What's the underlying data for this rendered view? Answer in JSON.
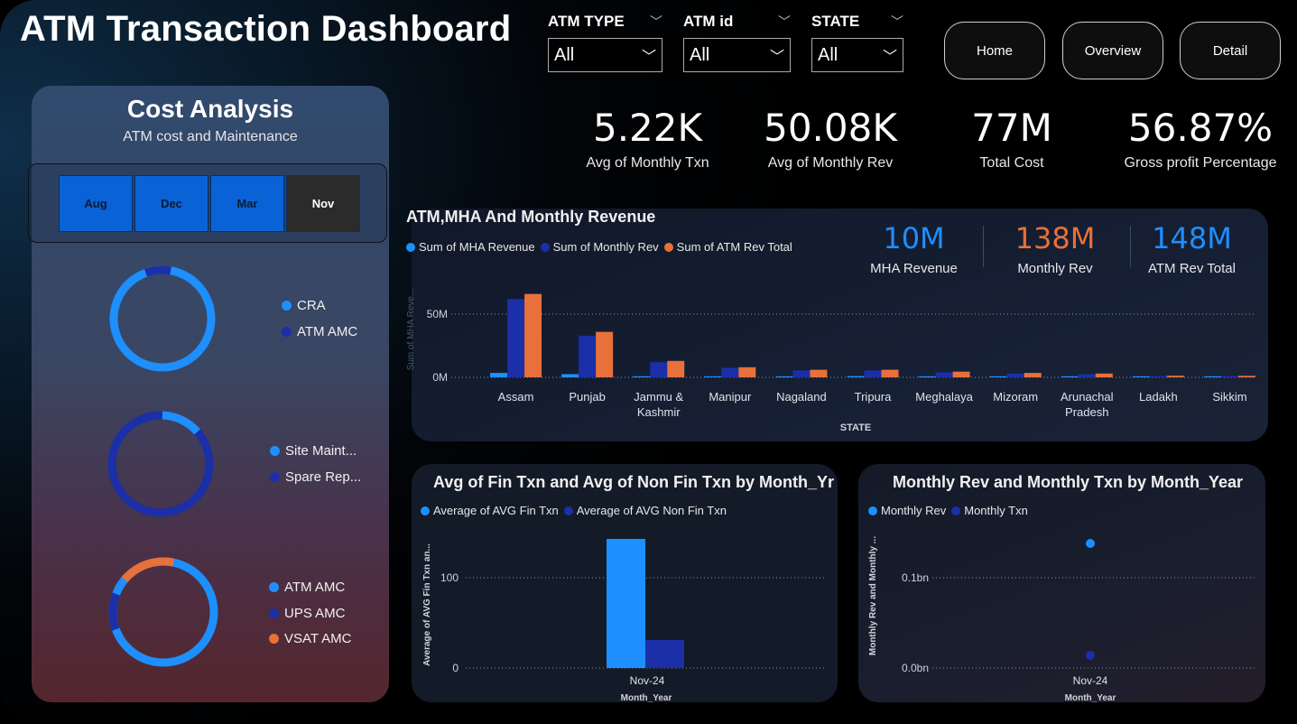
{
  "header": {
    "title": "ATM Transaction Dashboard"
  },
  "slicers": [
    {
      "label": "ATM TYPE",
      "value": "All"
    },
    {
      "label": "ATM id",
      "value": "All"
    },
    {
      "label": "STATE",
      "value": "All"
    }
  ],
  "nav": {
    "home": "Home",
    "overview": "Overview",
    "detail": "Detail"
  },
  "kpis": [
    {
      "value": "5.22K",
      "label": "Avg of Monthly Txn"
    },
    {
      "value": "50.08K",
      "label": "Avg of Monthly Rev"
    },
    {
      "value": "77M",
      "label": "Total Cost"
    },
    {
      "value": "56.87%",
      "label": "Gross profit Percentage"
    }
  ],
  "cost_panel": {
    "title": "Cost Analysis",
    "subtitle": "ATM cost and Maintenance",
    "months": [
      {
        "label": "Aug",
        "selected": false
      },
      {
        "label": "Dec",
        "selected": false
      },
      {
        "label": "Mar",
        "selected": false
      },
      {
        "label": "Nov",
        "selected": true
      }
    ],
    "donut1_legend": [
      "CRA",
      "ATM AMC"
    ],
    "donut2_legend": [
      "Site Maint...",
      "Spare Rep..."
    ],
    "donut3_legend": [
      "ATM AMC",
      "UPS AMC",
      "VSAT AMC"
    ]
  },
  "main_card": {
    "title": "ATM,MHA And Monthly Revenue",
    "legend": [
      "Sum of MHA Revenue",
      "Sum of Monthly Rev",
      "Sum of ATM Rev Total"
    ],
    "kpis": [
      {
        "value": "10M",
        "label": "MHA Revenue",
        "color": "#1e8fff"
      },
      {
        "value": "138M",
        "label": "Monthly Rev",
        "color": "#e8703a"
      },
      {
        "value": "148M",
        "label": "ATM Rev Total",
        "color": "#1e8fff"
      }
    ],
    "yaxis_label": "Sum of MHA Reve...",
    "xaxis_label": "STATE",
    "yticks": [
      "0M",
      "50M"
    ]
  },
  "fin_card": {
    "title": "Avg of Fin Txn and Avg of Non Fin Txn by Month_Yr",
    "legend": [
      "Average of AVG Fin Txn",
      "Average of AVG Non Fin Txn"
    ],
    "yaxis_label": "Average of AVG Fin Txn an...",
    "xaxis_label": "Month_Year",
    "yticks": [
      "0",
      "100"
    ]
  },
  "rev_card": {
    "title": "Monthly Rev and Monthly Txn by Month_Year",
    "legend": [
      "Monthly Rev",
      "Monthly Txn"
    ],
    "yaxis_label": "Monthly Rev and Monthly ...",
    "xaxis_label": "Month_Year",
    "yticks": [
      "0.0bn",
      "0.1bn"
    ]
  },
  "colors": {
    "mha": "#1e8fff",
    "monthly": "#1a2fa8",
    "atm": "#e8703a"
  },
  "chart_data": [
    {
      "type": "bar",
      "categories": [
        "Assam",
        "Punjab",
        "Jammu & Kashmir",
        "Manipur",
        "Nagaland",
        "Tripura",
        "Meghalaya",
        "Mizoram",
        "Arunachal Pradesh",
        "Ladakh",
        "Sikkim"
      ],
      "series": [
        {
          "name": "Sum of MHA Revenue",
          "values": [
            3.5,
            2.5,
            0.8,
            0.4,
            0.6,
            1.0,
            0.5,
            0.4,
            0.6,
            0.3,
            0.2
          ]
        },
        {
          "name": "Sum of Monthly Rev",
          "values": [
            62,
            33,
            12,
            7.5,
            5.5,
            5.5,
            4,
            3,
            2.5,
            1,
            1
          ]
        },
        {
          "name": "Sum of ATM Rev Total",
          "values": [
            66,
            36,
            13,
            8,
            6,
            6,
            4.5,
            3.5,
            3,
            1.3,
            1.2
          ]
        }
      ],
      "ylim": [
        0,
        70
      ],
      "xlabel": "STATE",
      "ylabel": "Sum of MHA Reve..."
    },
    {
      "type": "bar",
      "categories": [
        "Nov-24"
      ],
      "series": [
        {
          "name": "Average of AVG Fin Txn",
          "values": [
            143
          ]
        },
        {
          "name": "Average of AVG Non Fin Txn",
          "values": [
            31
          ]
        }
      ],
      "ylim": [
        0,
        150
      ],
      "xlabel": "Month_Year",
      "ylabel": "Average of AVG Fin Txn an..."
    },
    {
      "type": "scatter",
      "categories": [
        "Nov-24"
      ],
      "series": [
        {
          "name": "Monthly Rev",
          "values": [
            0.138
          ]
        },
        {
          "name": "Monthly Txn",
          "values": [
            0.014
          ]
        }
      ],
      "ylim": [
        0,
        0.15
      ],
      "xlabel": "Month_Year",
      "ylabel": "Monthly Rev and Monthly ..."
    }
  ]
}
